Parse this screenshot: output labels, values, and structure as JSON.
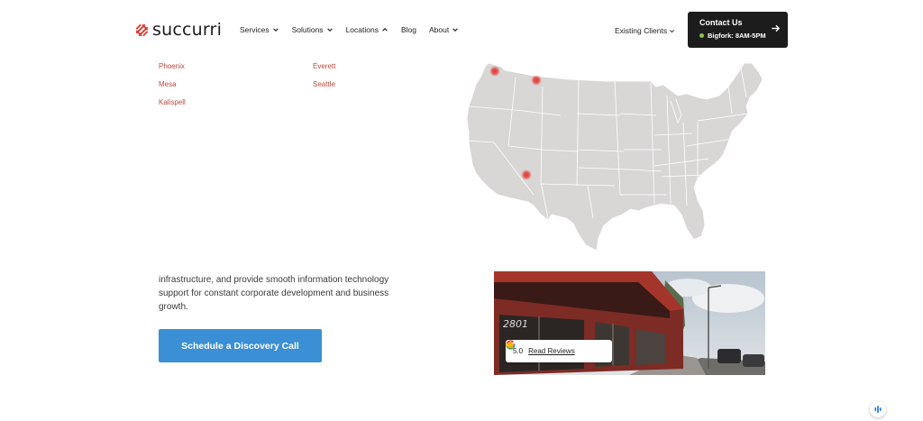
{
  "header": {
    "logo_text": "succurri",
    "nav": [
      {
        "label": "Services",
        "has_chevron": true,
        "chevron": "down"
      },
      {
        "label": "Solutions",
        "has_chevron": true,
        "chevron": "down"
      },
      {
        "label": "Locations",
        "has_chevron": true,
        "chevron": "up"
      },
      {
        "label": "Blog",
        "has_chevron": false
      },
      {
        "label": "About",
        "has_chevron": true,
        "chevron": "down"
      }
    ],
    "existing_clients": "Existing Clients",
    "contact": {
      "title": "Contact Us",
      "status": "Bigfork: 8AM-5PM",
      "status_color": "#8bc34a"
    }
  },
  "locations": {
    "column1": [
      "Phoenix",
      "Mesa",
      "Kalispell"
    ],
    "column2": [
      "Everett",
      "Seattle"
    ],
    "link_color": "#b84a3c"
  },
  "main": {
    "body_text": "infrastructure, and provide smooth information technology support for constant corporate development and business growth.",
    "cta_label": "Schedule a Discovery Call",
    "cta_color": "#3b8fd4"
  },
  "photo": {
    "building_number": "2801",
    "rating": "5.0",
    "read_reviews": "Read Reviews"
  },
  "colors": {
    "map_fill": "#d9d6d6",
    "map_marker": "#e53935",
    "brand_red": "#d83a2e"
  }
}
